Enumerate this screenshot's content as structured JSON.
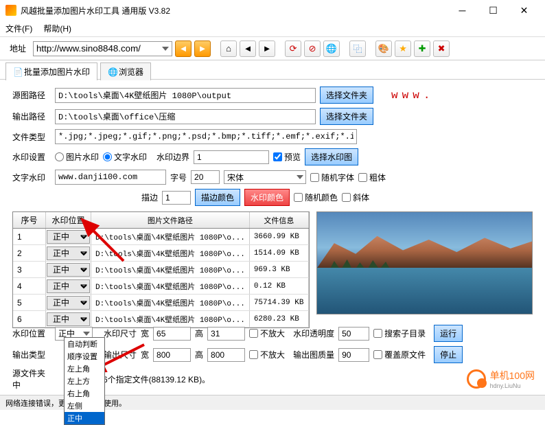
{
  "window": {
    "title": "风越批量添加图片水印工具 通用版 V3.82"
  },
  "menu": {
    "file": "文件(F)",
    "help": "帮助(H)"
  },
  "address": {
    "label": "地址",
    "url": "http://www.sino8848.com/"
  },
  "tabs": {
    "main": "批量添加图片水印",
    "browser": "浏览器"
  },
  "labels": {
    "sourcePath": "源图路径",
    "outputPath": "输出路径",
    "fileType": "文件类型",
    "wmSetting": "水印设置",
    "textWm": "文字水印",
    "stroke": "描边",
    "fontSize": "字号",
    "wmBorder": "水印边界",
    "wmPos": "水印位置",
    "outType": "输出类型",
    "srcFolder": "源文件夹中",
    "wmSize": "水印尺寸",
    "outSize": "输出尺寸",
    "width": "宽",
    "height": "高",
    "wmOpacity": "水印透明度",
    "outQuality": "输出图质量"
  },
  "values": {
    "sourcePath": "D:\\tools\\桌面\\4K壁纸图片 1080P\\output",
    "outputPath": "D:\\tools\\桌面\\office\\压缩",
    "fileType": "*.jpg;*.jpeg;*.gif;*.png;*.psd;*.bmp;*.tiff;*.emf;*.exif;*.ico;*.wmf",
    "textWm": "www.danji100.com",
    "fontSize": "20",
    "font": "宋体",
    "stroke": "1",
    "wmBorder": "1",
    "srcFolder": "6个指定文件(88139.12 KB)。",
    "wmW": "65",
    "wmH": "31",
    "outW": "800",
    "outH": "800",
    "opacity": "50",
    "quality": "90",
    "posSelected": "正中"
  },
  "buttons": {
    "selectFolder": "选择文件夹",
    "strokeColor": "描边颜色",
    "wmColor": "水印颜色",
    "selectWmImg": "选择水印图",
    "run": "运行",
    "stop": "停止"
  },
  "radios": {
    "imgWm": "图片水印",
    "textWm": "文字水印"
  },
  "checks": {
    "preview": "预览",
    "randFont": "随机字体",
    "bold": "粗体",
    "randColor": "随机颜色",
    "italic": "斜体",
    "noEnlarge": "不放大",
    "searchSub": "搜索子目录",
    "overwrite": "覆盖原文件"
  },
  "wwwText": "www.",
  "table": {
    "headers": {
      "seq": "序号",
      "pos": "水印位置",
      "path": "图片文件路径",
      "info": "文件信息"
    },
    "rows": [
      {
        "seq": "1",
        "pos": "正中",
        "path": "D:\\tools\\桌面\\4K壁纸图片 1080P\\o...",
        "info": "3660.99 KB"
      },
      {
        "seq": "2",
        "pos": "正中",
        "path": "D:\\tools\\桌面\\4K壁纸图片 1080P\\o...",
        "info": "1514.09 KB"
      },
      {
        "seq": "3",
        "pos": "正中",
        "path": "D:\\tools\\桌面\\4K壁纸图片 1080P\\o...",
        "info": "969.3 KB"
      },
      {
        "seq": "4",
        "pos": "正中",
        "path": "D:\\tools\\桌面\\4K壁纸图片 1080P\\o...",
        "info": "0.12 KB"
      },
      {
        "seq": "5",
        "pos": "正中",
        "path": "D:\\tools\\桌面\\4K壁纸图片 1080P\\o...",
        "info": "75714.39 KB"
      },
      {
        "seq": "6",
        "pos": "正中",
        "path": "D:\\tools\\桌面\\4K壁纸图片 1080P\\o...",
        "info": "6280.23 KB"
      }
    ]
  },
  "dropdown": {
    "options": [
      "自动判断",
      "顺序设置",
      "左上角",
      "左上方",
      "右上角",
      "左侧",
      "正中"
    ]
  },
  "status": "网络连接错误，更新功能无法使用。",
  "watermark": {
    "name": "单机100网",
    "sub": "hdny.LiuNu"
  }
}
